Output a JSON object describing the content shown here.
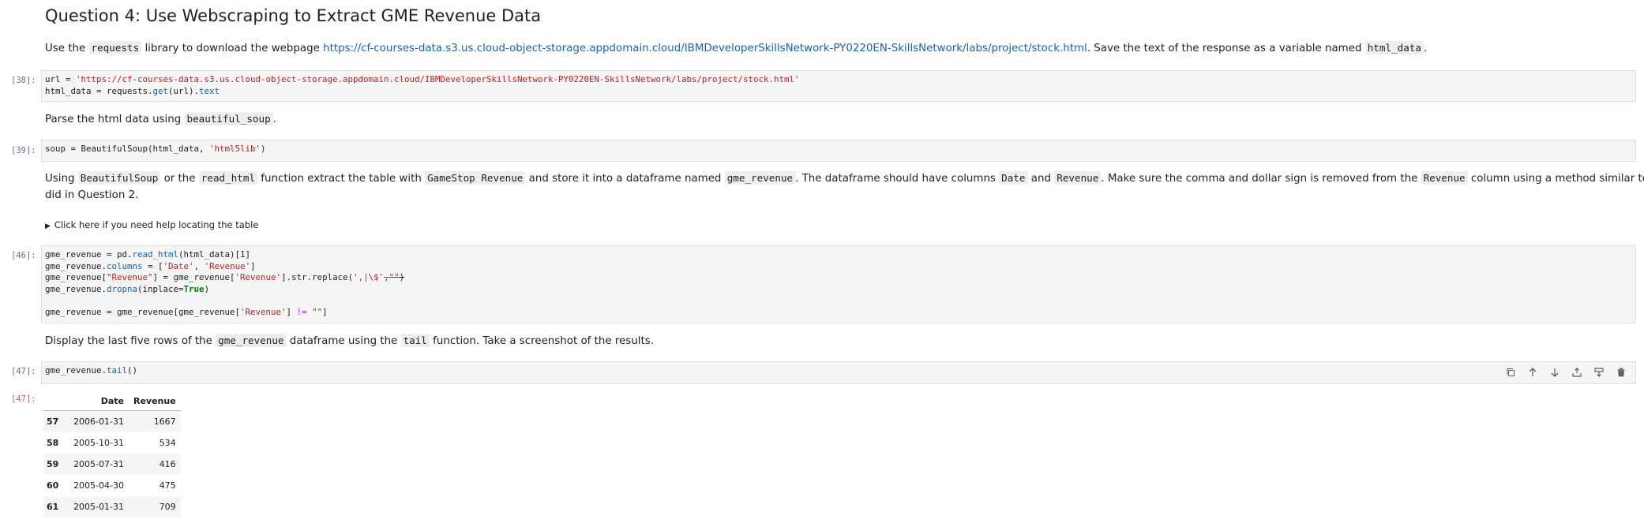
{
  "heading": "Question 4: Use Webscraping to Extract GME Revenue Data",
  "p1": {
    "t1": "Use the ",
    "c1": "requests",
    "t2": " library to download the webpage ",
    "link": "https://cf-courses-data.s3.us.cloud-object-storage.appdomain.cloud/IBMDeveloperSkillsNetwork-PY0220EN-SkillsNetwork/labs/project/stock.html",
    "t3": ". Save the text of the response as a variable named ",
    "c2": "html_data",
    "t4": "."
  },
  "cell38": {
    "prompt": "[38]:",
    "l1a": "url = ",
    "l1b": "'https://cf-courses-data.s3.us.cloud-object-storage.appdomain.cloud/IBMDeveloperSkillsNetwork-PY0220EN-SkillsNetwork/labs/project/stock.html'",
    "l2a": "html_data = requests.",
    "l2b": "get",
    "l2c": "(url).",
    "l2d": "text"
  },
  "p2": {
    "t1": "Parse the html data using ",
    "c1": "beautiful_soup",
    "t2": "."
  },
  "cell39": {
    "prompt": "[39]:",
    "a": "soup = BeautifulSoup(html_data, ",
    "b": "'html5lib'",
    "c": ")"
  },
  "p3": {
    "t1": "Using ",
    "c1": "BeautifulSoup",
    "t2": " or the ",
    "c2": "read_html",
    "t3": " function extract the table with ",
    "c3": "GameStop Revenue",
    "t4": " and store it into a dataframe named ",
    "c4": "gme_revenue",
    "t5": ". The dataframe should have columns ",
    "c5": "Date",
    "t6": " and ",
    "c6": "Revenue",
    "t7": ". Make sure the comma and dollar sign is removed from the ",
    "c7": "Revenue",
    "t8": " column using a method similar to what you",
    "line2": "did in Question 2."
  },
  "details": "Click here if you need help locating the table",
  "cell46": {
    "prompt": "[46]:",
    "l1a": "gme_revenue = pd.",
    "l1b": "read_html",
    "l1c": "(html_data)[1]",
    "l2a": "gme_revenue.",
    "l2b": "columns",
    "l2c": " = [",
    "l2d": "'Date'",
    "l2e": ", ",
    "l2f": "'Revenue'",
    "l2g": "]",
    "l3a": "gme_revenue[",
    "l3b": "\"Revenue\"",
    "l3c": "] = gme_revenue[",
    "l3d": "'Revenue'",
    "l3e": "].str.replace(",
    "l3f": "',|\\$'",
    "l3g": ",",
    "l3h": "\"\"",
    "l3i": ")",
    "l4a": "gme_revenue.",
    "l4b": "dropna",
    "l4c": "(inplace=",
    "l4d": "True",
    "l4e": ")",
    "l5a": "gme_revenue = gme_revenue[gme_revenue[",
    "l5b": "'Revenue'",
    "l5c": "] ",
    "l5d": "!=",
    "l5e": " ",
    "l5f": "\"\"",
    "l5g": "]"
  },
  "p4": {
    "t1": "Display the last five rows of the ",
    "c1": "gme_revenue",
    "t2": " dataframe using the ",
    "c2": "tail",
    "t3": " function. Take a screenshot of the results."
  },
  "cell47": {
    "prompt": "[47]:",
    "a": "gme_revenue.",
    "b": "tail",
    "c": "()",
    "toolbar_icons": [
      "copy-icon",
      "arrow-up-icon",
      "arrow-down-icon",
      "insert-above-icon",
      "insert-below-icon",
      "delete-icon"
    ]
  },
  "output47": {
    "prompt": "[47]:",
    "columns": [
      "Date",
      "Revenue"
    ],
    "rows": [
      {
        "index": "57",
        "date": "2006-01-31",
        "revenue": "1667"
      },
      {
        "index": "58",
        "date": "2005-10-31",
        "revenue": "534"
      },
      {
        "index": "59",
        "date": "2005-07-31",
        "revenue": "416"
      },
      {
        "index": "60",
        "date": "2005-04-30",
        "revenue": "475"
      },
      {
        "index": "61",
        "date": "2005-01-31",
        "revenue": "709"
      }
    ]
  }
}
